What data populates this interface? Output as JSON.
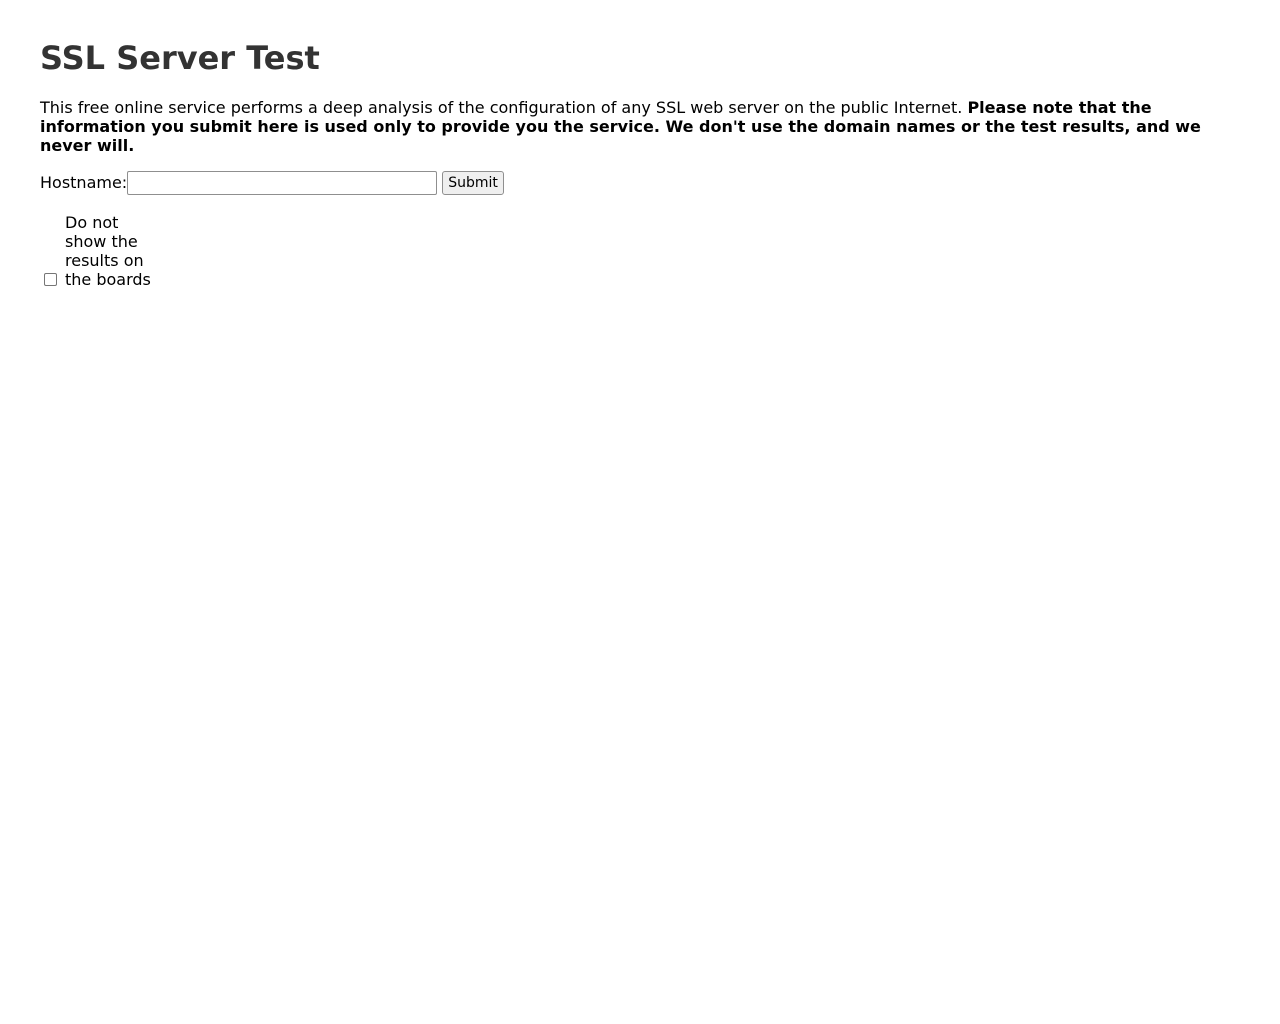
{
  "page": {
    "title": "SSL Server Test",
    "intro_text": "This free online service performs a deep analysis of the configuration of any SSL web server on the public Internet.",
    "intro_bold": "Please note that the information you submit here is used only to provide you the service. We don't use the domain names or the test results, and we never will."
  },
  "form": {
    "hostname_label": "Hostname:",
    "hostname_value": "",
    "hostname_placeholder": "",
    "submit_label": "Submit",
    "hide_results_label": "Do not show the results on the boards",
    "hide_results_checked": false
  }
}
